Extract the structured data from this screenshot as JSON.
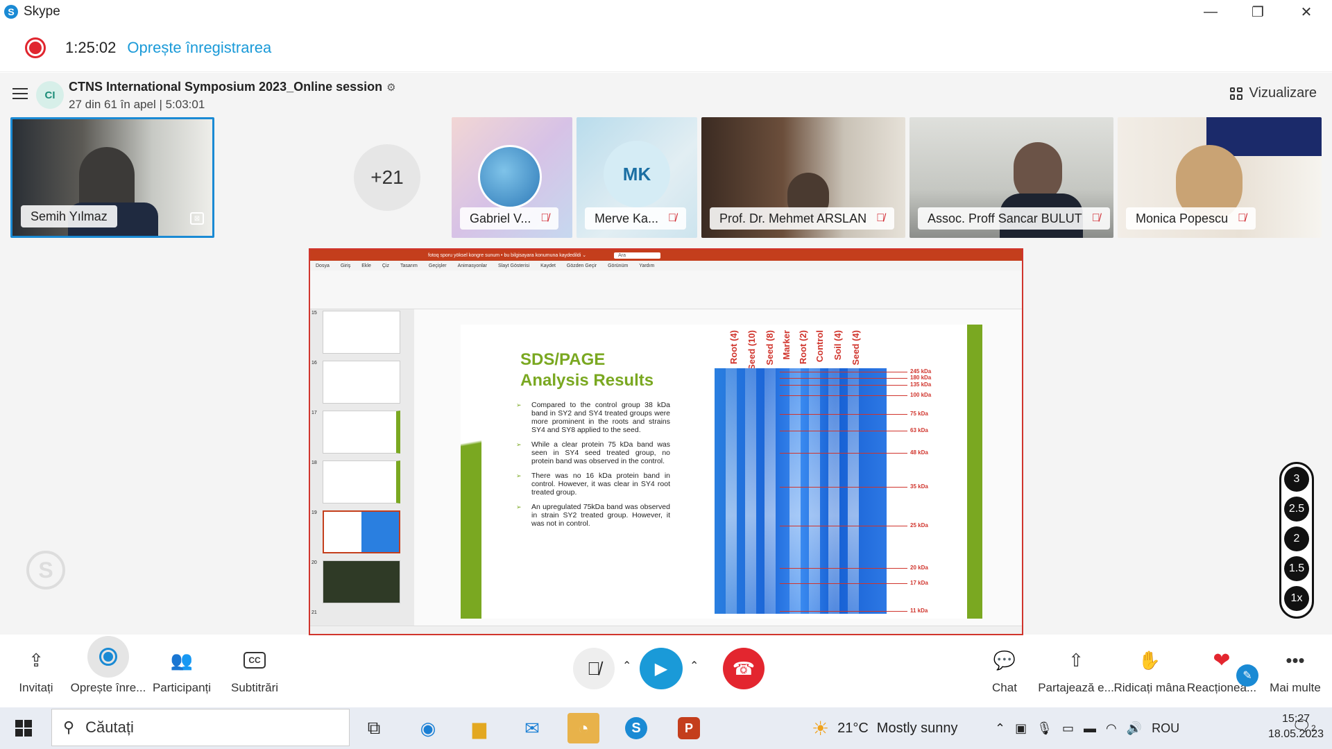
{
  "app": {
    "title": "Skype"
  },
  "recording": {
    "time": "1:25:02",
    "stop_label": "Oprește înregistrarea"
  },
  "call": {
    "avatar_initials": "CI",
    "title": "CTNS International Symposium 2023_Online session",
    "subtitle": "27 din 61 în apel | 5:03:01",
    "view_label": "Vizualizare",
    "extra_participants": "+21"
  },
  "participants": [
    {
      "name": "Semih Yılmaz"
    },
    {
      "name": "Gabriel V..."
    },
    {
      "name": "Merve Ka...",
      "initials": "MK"
    },
    {
      "name": "Prof. Dr. Mehmet ARSLAN"
    },
    {
      "name": "Assoc. Proff Sancar BULUT"
    },
    {
      "name": "Monica Popescu"
    }
  ],
  "presentation": {
    "window_title": "fotoq sporu yöksel kongre sunum • bu bilgisayara konumuna kaydedildi ⌄",
    "search": "Ara",
    "menu": [
      "Dosya",
      "Giriş",
      "Ekle",
      "Çiz",
      "Tasarım",
      "Geçişler",
      "Animasyonlar",
      "Slayt Gösterisi",
      "Kaydet",
      "Gözden Geçir",
      "Görünüm",
      "Yardım"
    ],
    "slide_numbers": [
      "15",
      "16",
      "17",
      "18",
      "19",
      "20",
      "21"
    ],
    "slide": {
      "title_line1": "SDS/PAGE",
      "title_line2": "Analysis Results",
      "bullets": [
        "Compared to the control group 38 kDa band in SY2 and SY4 treated groups were more prominent in the roots and strains SY4 and SY8 applied to the seed.",
        "While a clear protein 75 kDa band was seen in SY4 seed treated group, no protein band was observed in the control.",
        "There was no 16 kDa protein band in control. However, it was clear in SY4 root treated group.",
        "An upregulated 75kDa band was observed in strain SY2 treated group. However, it was not in control."
      ],
      "lanes": [
        "Root (4)",
        "Seed (10)",
        "Seed (8)",
        "Marker",
        "Root (2)",
        "Control",
        "Soil (4)",
        "Seed (4)"
      ],
      "markers": [
        "245 kDa",
        "180 kDa",
        "135 kDa",
        "100 kDa",
        "75 kDa",
        "63 kDa",
        "48 kDa",
        "35 kDa",
        "25 kDa",
        "20 kDa",
        "17 kDa",
        "11 kDa"
      ]
    }
  },
  "zoom_levels": [
    "3",
    "2.5",
    "2",
    "1.5",
    "1x"
  ],
  "controls": {
    "invite": "Invitați",
    "stop_recording": "Oprește înre...",
    "participants": "Participanți",
    "subtitles": "Subtitrări",
    "chat": "Chat",
    "share": "Partajează e...",
    "raise_hand": "Ridicați mâna",
    "react": "Reacționea...",
    "more": "Mai multe"
  },
  "taskbar": {
    "search_placeholder": "Căutați",
    "weather_temp": "21°C",
    "weather_desc": "Mostly sunny",
    "language": "ROU",
    "time": "15:27",
    "date": "18.05.2023",
    "notifications": "2"
  }
}
